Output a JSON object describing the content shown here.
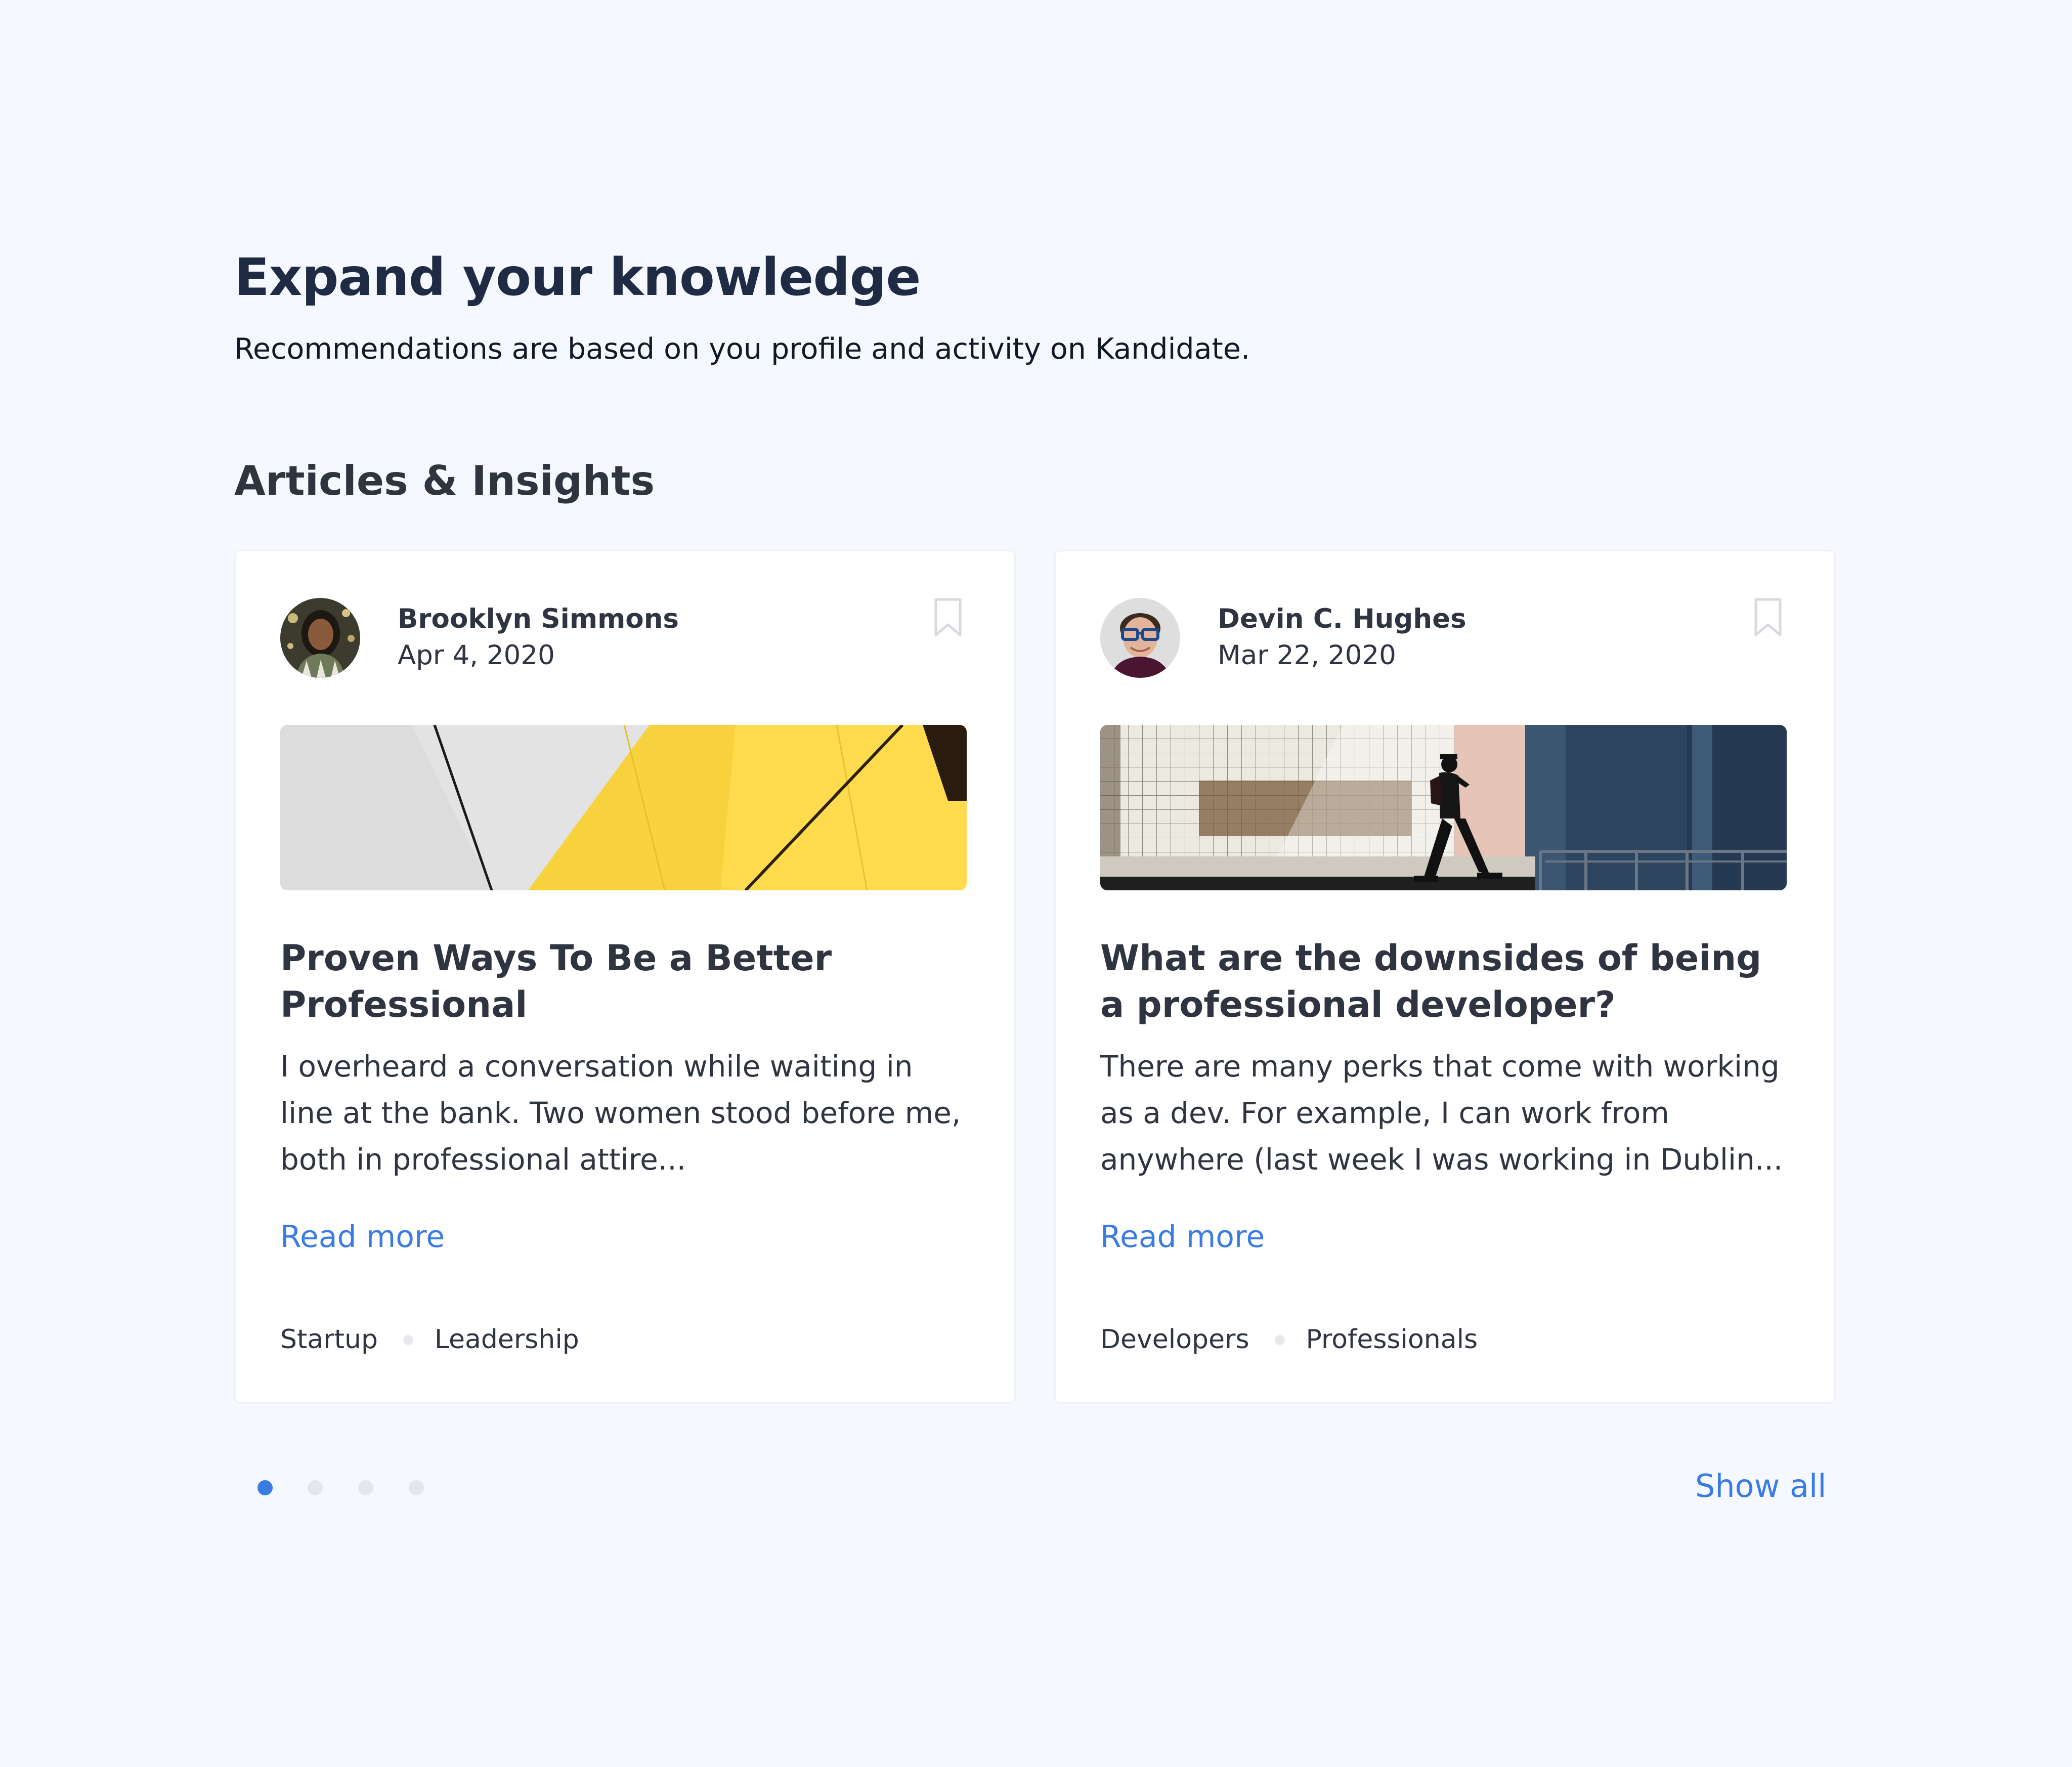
{
  "header": {
    "title": "Expand your knowledge",
    "subtitle": "Recommendations are based on you profile and activity on Kandidate."
  },
  "section": {
    "title": "Articles & Insights"
  },
  "articles": [
    {
      "author": "Brooklyn Simmons",
      "date": "Apr 4, 2020",
      "title": "Proven Ways To Be a Better Professional",
      "excerpt": "I overheard a conversation while waiting in line at the bank. Two women stood before me, both in professional attire...",
      "read_more": "Read more",
      "tags": [
        "Startup",
        "Leadership"
      ],
      "bookmark_icon": "bookmark-outline-icon"
    },
    {
      "author": "Devin C. Hughes",
      "date": "Mar 22, 2020",
      "title": "What are the downsides of being a professional developer?",
      "excerpt": "There are many perks that come with working as a dev. For example, I can work from anywhere (last week I was working in Dublin...",
      "read_more": "Read more",
      "tags": [
        "Developers",
        "Professionals"
      ],
      "bookmark_icon": "bookmark-outline-icon"
    }
  ],
  "pagination": {
    "total": 4,
    "active_index": 0
  },
  "show_all": "Show all",
  "colors": {
    "background": "#f5f8fe",
    "accent": "#3b7ce4",
    "heading": "#1f2a44",
    "text": "#2f3540",
    "card": "#ffffff"
  }
}
